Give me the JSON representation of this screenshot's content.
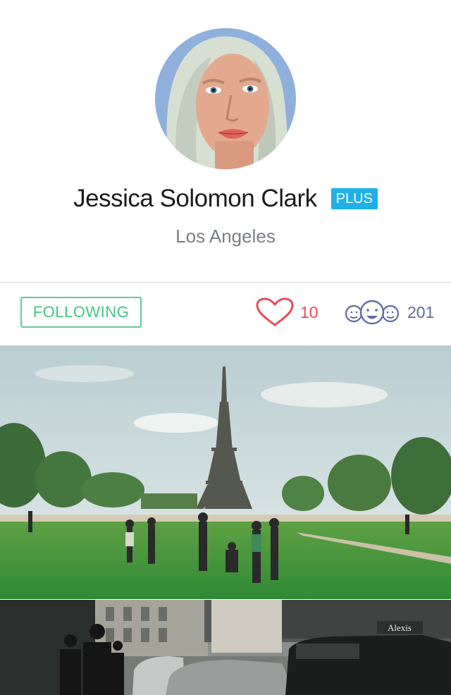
{
  "profile": {
    "name": "Jessica Solomon Clark",
    "badge": "PLUS",
    "location": "Los Angeles"
  },
  "actions": {
    "follow_button": "FOLLOWING"
  },
  "stats": {
    "likes": "10",
    "followers": "201"
  },
  "photos": {
    "sign_text": "Alexis"
  },
  "colors": {
    "badge": "#1fb0e8",
    "follow_accent": "#47c585",
    "likes": "#e84b5c",
    "followers": "#5f6aa8"
  },
  "icons": {
    "likes": "heart-icon",
    "followers": "group-faces-icon"
  }
}
